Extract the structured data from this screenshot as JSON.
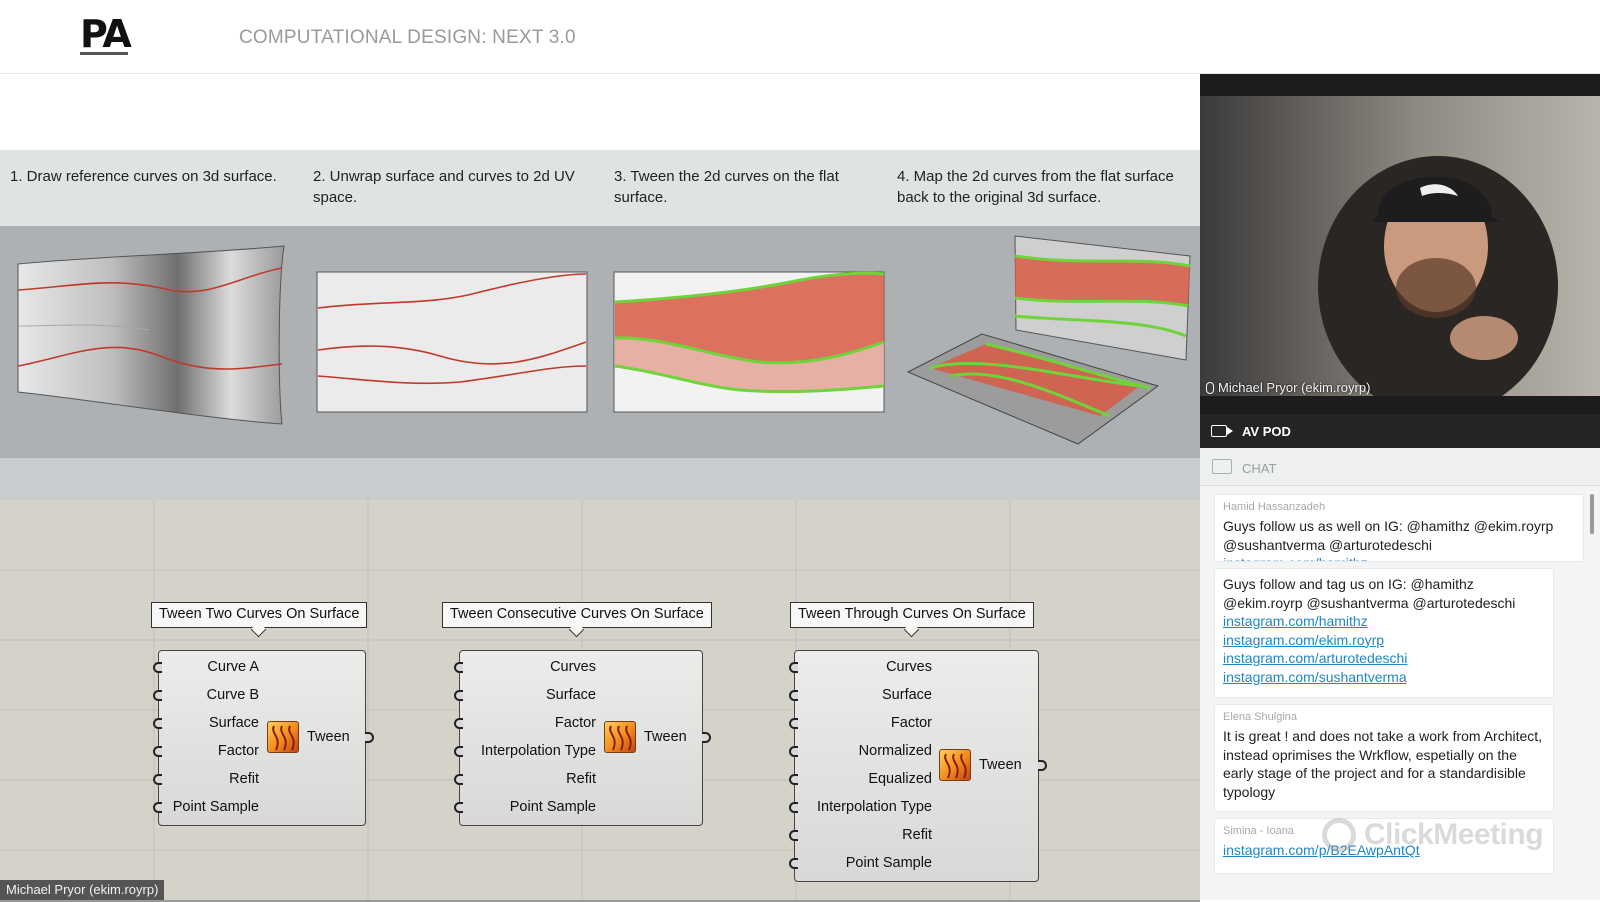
{
  "header": {
    "logo": "PA",
    "event_title": "COMPUTATIONAL DESIGN: NEXT 3.0"
  },
  "slide": {
    "steps": [
      "1. Draw reference curves on 3d surface.",
      "2. Unwrap surface and curves to 2d UV space.",
      "3. Tween the 2d curves on the flat surface.",
      "4. Map the 2d curves from the flat surface back to the original 3d surface."
    ],
    "components": [
      {
        "label": "Tween Two Curves On Surface",
        "inputs": [
          "Curve A",
          "Curve B",
          "Surface",
          "Factor",
          "Refit",
          "Point Sample"
        ],
        "output": "Tween"
      },
      {
        "label": "Tween Consecutive Curves On Surface",
        "inputs": [
          "Curves",
          "Surface",
          "Factor",
          "Interpolation Type",
          "Refit",
          "Point Sample"
        ],
        "output": "Tween"
      },
      {
        "label": "Tween Through Curves On Surface",
        "inputs": [
          "Curves",
          "Surface",
          "Factor",
          "Normalized",
          "Equalized",
          "Interpolation Type",
          "Refit",
          "Point Sample"
        ],
        "output": "Tween"
      }
    ],
    "presenter_label": "Michael Pryor (ekim.royrp)",
    "colors": {
      "curve_red": "#c0392b",
      "curve_green": "#6fd43a",
      "canvas_bg": "#d4d2c9"
    }
  },
  "video": {
    "caption": "Michael Pryor (ekim.royrp)"
  },
  "avpod": {
    "label": "AV POD",
    "icon": "camera-icon"
  },
  "chat": {
    "header": "CHAT",
    "icon": "chat-bubble-icon",
    "messages": [
      {
        "author": "Hamid Hassanzadeh",
        "text": "Guys follow us as well on IG: @hamithz @ekim.royrp @sushantverma @arturotedeschi",
        "links": [
          "instagram.com/hamithz"
        ]
      },
      {
        "author": "",
        "text": "Guys follow and tag us on IG: @hamithz @ekim.royrp @sushantverma @arturotedeschi",
        "links": [
          "instagram.com/hamithz",
          "instagram.com/ekim.royrp",
          "instagram.com/arturotedeschi",
          "instagram.com/sushantverma"
        ]
      },
      {
        "author": "Elena Shulgina",
        "text": "It is great ! and does not take a work from Architect, instead oprimises the Wrkflow, espetially on the early stage of the project and for a standardisible typology",
        "links": []
      },
      {
        "author": "Simina - Ioana",
        "text": "",
        "links": [
          "instagram.com/p/B2EAwpAntQt"
        ]
      }
    ],
    "watermark": "ClickMeeting"
  }
}
